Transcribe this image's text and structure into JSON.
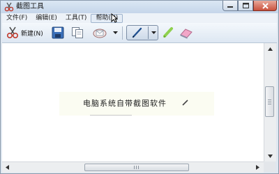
{
  "window": {
    "title": "截图工具"
  },
  "menu": [
    {
      "label": "文件(F)"
    },
    {
      "label": "编辑(E)"
    },
    {
      "label": "工具(T)"
    },
    {
      "label": "帮助(H)"
    }
  ],
  "toolbar": {
    "new_label": "新建(N)"
  },
  "canvas": {
    "snip_text": "电脑系统自带截图软件"
  },
  "icons": {
    "app": "scissors-icon",
    "new": "scissors-icon",
    "save": "floppy-disk-icon",
    "copy": "copy-icon",
    "send": "send-snip-icon",
    "pen": "pen-icon",
    "highlighter": "highlighter-icon",
    "eraser": "eraser-icon"
  },
  "colors": {
    "highlighter": "#8fd14f",
    "eraser": "#f2a6c8",
    "pen_active": "#cbd8e8"
  }
}
